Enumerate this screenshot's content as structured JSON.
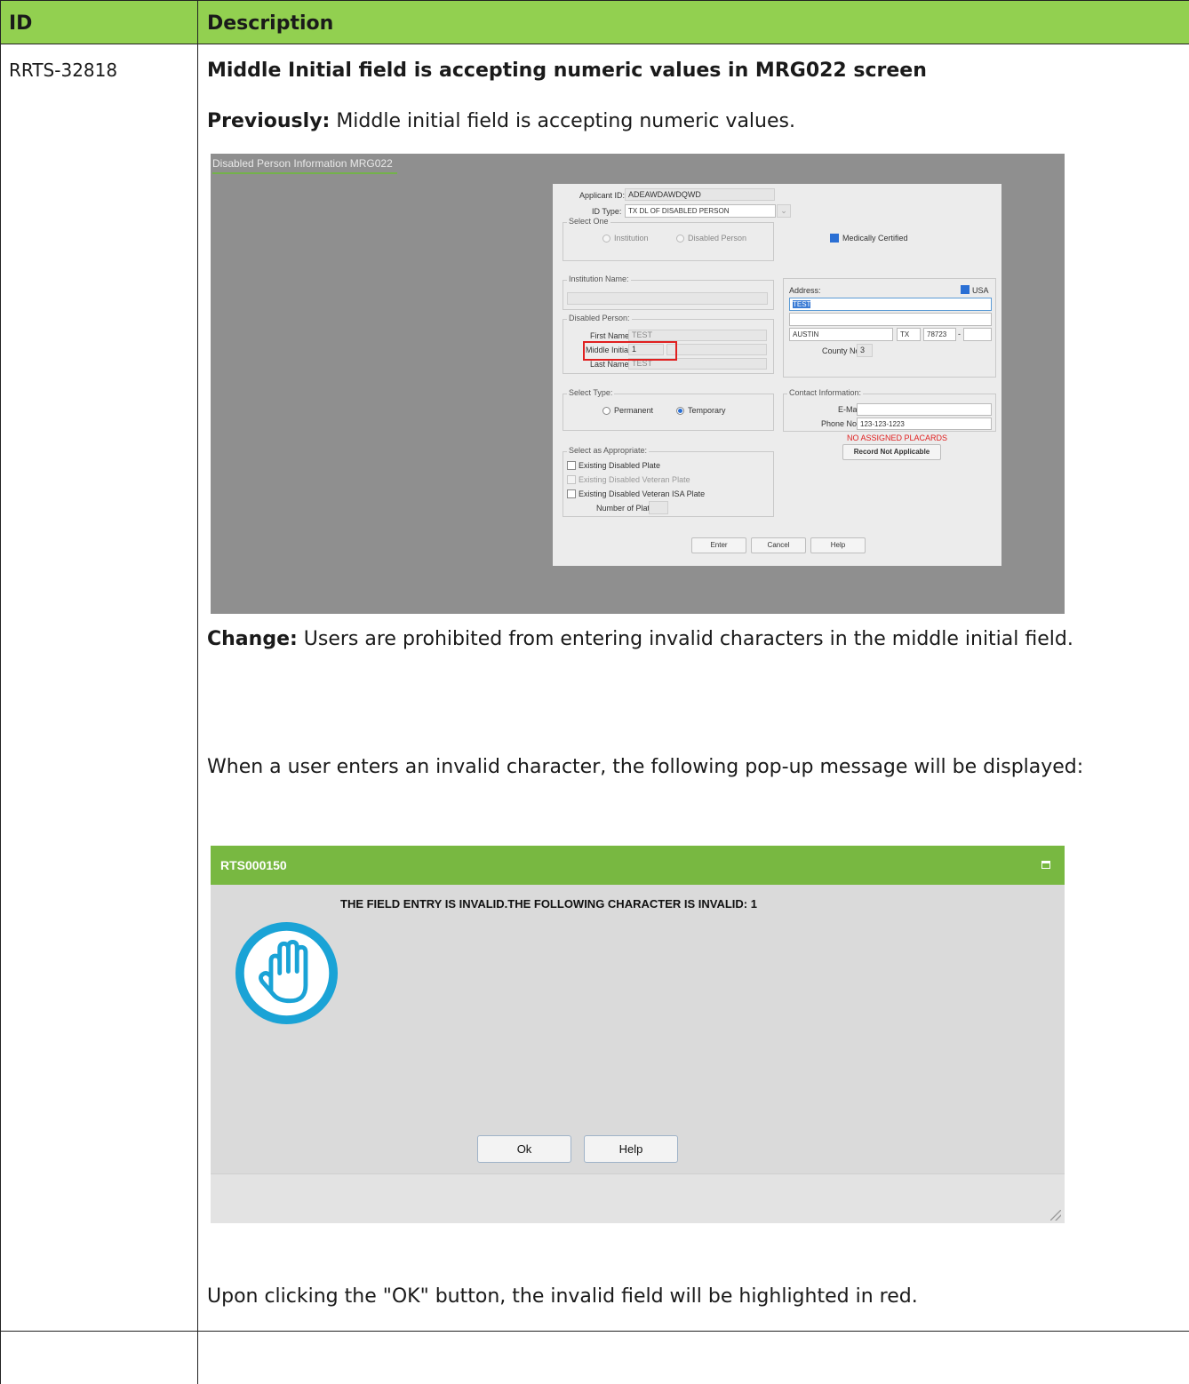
{
  "table": {
    "header_id": "ID",
    "header_description": "Description"
  },
  "row": {
    "id": "RRTS-32818",
    "title": "Middle Initial field is accepting numeric values in MRG022 screen",
    "previously_label": "Previously:",
    "previously_text": " Middle initial field is accepting numeric values.",
    "change_label": "Change:",
    "change_text": " Users are prohibited from entering invalid characters in the middle initial field.",
    "popup_intro": "When a user enters an invalid character, the following pop-up message will be displayed:",
    "after_ok": "Upon clicking the \"OK\" button, the invalid field will be highlighted in red."
  },
  "screen1": {
    "title": "Disabled Person Information MRG022",
    "applicant_id_label": "Applicant ID:",
    "applicant_id_value": "ADEAWDAWDQWD",
    "id_type_label": "ID Type:",
    "id_type_value": "TX DL OF DISABLED PERSON",
    "select_one_label": "Select One",
    "radio_institution": "Institution",
    "radio_disabled_person": "Disabled Person",
    "medically_certified": "Medically Certified",
    "institution_name_label": "Institution Name:",
    "address_label": "Address:",
    "usa_label": "USA",
    "address_line1": "TEST",
    "city": "AUSTIN",
    "state": "TX",
    "zip": "78723",
    "county_no_label": "County No:",
    "county_no_value": "3",
    "disabled_person_label": "Disabled Person:",
    "first_name_label": "First Name:",
    "first_name_value": "TEST",
    "middle_initial_label": "Middle Initial:",
    "middle_initial_value": "1",
    "last_name_label": "Last Name:",
    "last_name_value": "TEST",
    "select_type_label": "Select Type:",
    "permanent_label": "Permanent",
    "temporary_label": "Temporary",
    "contact_info_label": "Contact Information:",
    "email_label": "E-Mail:",
    "phone_label": "Phone No:",
    "phone_value": "123-123-1223",
    "no_placards": "NO ASSIGNED PLACARDS",
    "record_not_applicable": "Record Not Applicable",
    "select_appropriate_label": "Select as Appropriate:",
    "existing_disabled_plate": "Existing Disabled Plate",
    "existing_veteran_plate": "Existing Disabled Veteran Plate",
    "existing_veteran_isa_plate": "Existing Disabled Veteran ISA Plate",
    "number_of_plates_label": "Number of Plates:",
    "enter_button": "Enter",
    "cancel_button": "Cancel",
    "help_button": "Help"
  },
  "screen2": {
    "title": "RTS000150",
    "message": "THE FIELD ENTRY IS INVALID.THE FOLLOWING CHARACTER IS INVALID: 1",
    "ok_button": "Ok",
    "help_button": "Help",
    "icon": "stop-hand-icon"
  },
  "colors": {
    "header_green": "#92d050",
    "dialog_green": "#78b841",
    "icon_blue": "#1aa3d6",
    "highlight_red": "#e02020"
  }
}
